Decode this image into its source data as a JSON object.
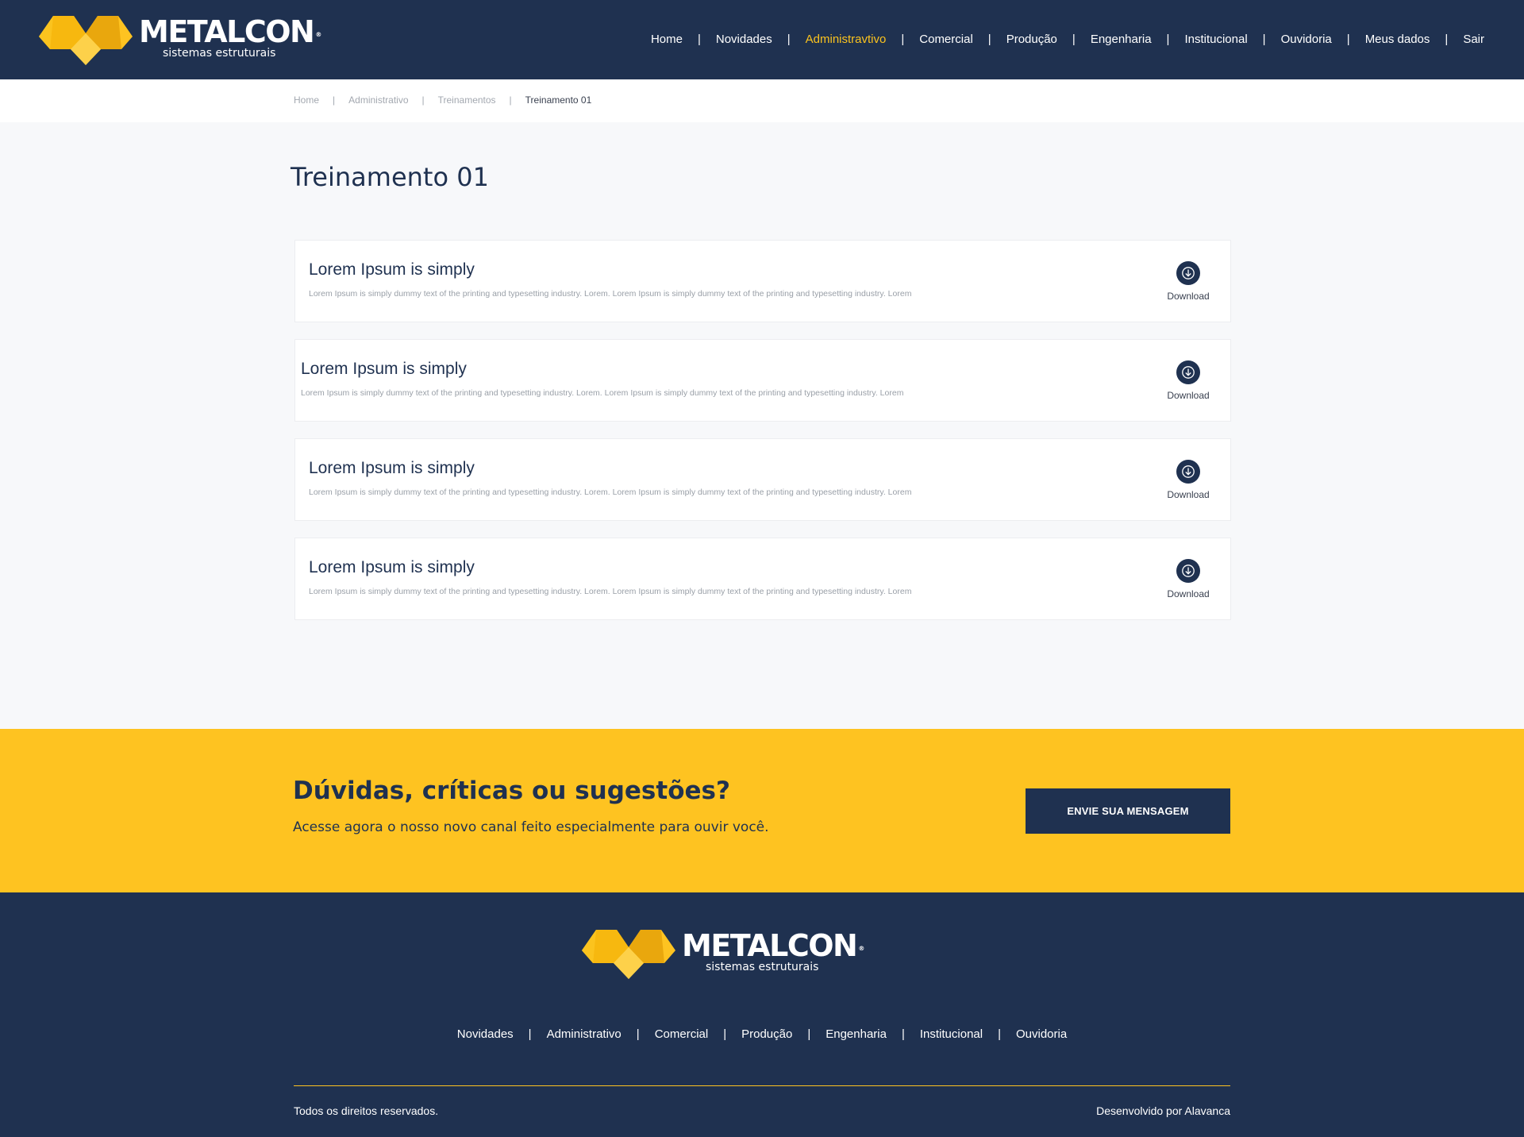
{
  "brand": {
    "name": "METALCON",
    "registered": "®",
    "tagline": "sistemas estruturais",
    "colors": {
      "navy": "#1f3150",
      "yellow": "#fec321",
      "active_link": "#fbc31e"
    }
  },
  "header": {
    "nav": [
      {
        "label": "Home",
        "active": false
      },
      {
        "label": "Novidades",
        "active": false
      },
      {
        "label": "Administravtivo",
        "active": true
      },
      {
        "label": "Comercial",
        "active": false
      },
      {
        "label": "Produção",
        "active": false
      },
      {
        "label": "Engenharia",
        "active": false
      },
      {
        "label": "Institucional",
        "active": false
      },
      {
        "label": "Ouvidoria",
        "active": false
      },
      {
        "label": "Meus dados",
        "active": false
      },
      {
        "label": "Sair",
        "active": false
      }
    ],
    "separator": "|"
  },
  "breadcrumb": {
    "items": [
      "Home",
      "Administrativo",
      "Treinamentos"
    ],
    "current": "Treinamento 01",
    "separator": "|"
  },
  "main": {
    "title": "Treinamento 01",
    "items": [
      {
        "title": "Lorem Ipsum is simply",
        "description": "Lorem Ipsum is simply dummy text of the printing and typesetting industry. Lorem. Lorem Ipsum is simply dummy text of the printing and typesetting industry. Lorem",
        "download_label": "Download",
        "icon": "download-icon"
      },
      {
        "title": "Lorem Ipsum is simply",
        "description": "Lorem Ipsum is simply dummy text of the printing and typesetting industry. Lorem. Lorem Ipsum is simply dummy text of the printing and typesetting industry. Lorem",
        "download_label": "Download",
        "icon": "download-icon"
      },
      {
        "title": "Lorem Ipsum is simply",
        "description": "Lorem Ipsum is simply dummy text of the printing and typesetting industry. Lorem. Lorem Ipsum is simply dummy text of the printing and typesetting industry. Lorem",
        "download_label": "Download",
        "icon": "download-icon"
      },
      {
        "title": "Lorem Ipsum is simply",
        "description": "Lorem Ipsum is simply dummy text of the printing and typesetting industry. Lorem. Lorem Ipsum is simply dummy text of the printing and typesetting industry. Lorem",
        "download_label": "Download",
        "icon": "download-icon"
      }
    ]
  },
  "cta": {
    "title": "Dúvidas, críticas ou sugestões?",
    "subtitle": "Acesse agora o nosso novo canal feito especialmente para ouvir você.",
    "button_label": "ENVIE SUA MENSAGEM"
  },
  "footer": {
    "nav": [
      "Novidades",
      "Administrativo",
      "Comercial",
      "Produção",
      "Engenharia",
      "Institucional",
      "Ouvidoria"
    ],
    "separator": "|",
    "copyright": "Todos os direitos reservados.",
    "credit": "Desenvolvido por Alavanca"
  }
}
